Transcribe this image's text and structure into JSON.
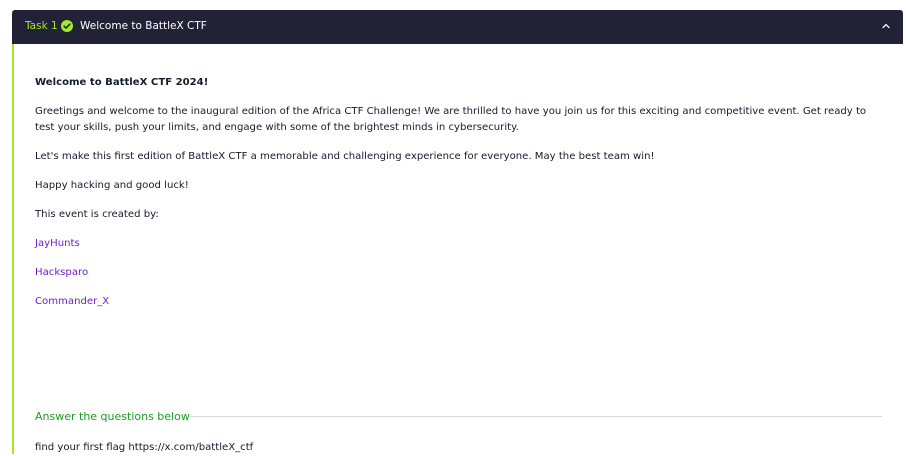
{
  "task": {
    "label": "Task 1",
    "title": "Welcome to BattleX CTF",
    "completed": true,
    "accent_color": "#a3ea2a",
    "header_bg": "#212235",
    "icons": {
      "status": "check-circle-icon",
      "toggle": "chevron-up-icon"
    }
  },
  "content": {
    "heading": "Welcome to BattleX CTF 2024!",
    "paragraphs": [
      "Greetings and welcome to the inaugural edition of the Africa CTF Challenge! We are thrilled to have you join us for this exciting and competitive event. Get ready to test your skills, push your limits, and engage with some of the brightest minds in cybersecurity.",
      "Let's make this first edition of BattleX CTF a memorable and challenging experience for everyone. May the best team win!",
      "Happy hacking and good luck!",
      "This event is created by:"
    ],
    "creators": [
      "JayHunts",
      "Hacksparo",
      "Commander_X"
    ],
    "link_color": "#6c1ec9"
  },
  "questions": {
    "section_title": "Answer the questions below",
    "section_title_color": "#1f9c1f",
    "items": [
      "find your first flag https://x.com/battleX_ctf"
    ]
  }
}
